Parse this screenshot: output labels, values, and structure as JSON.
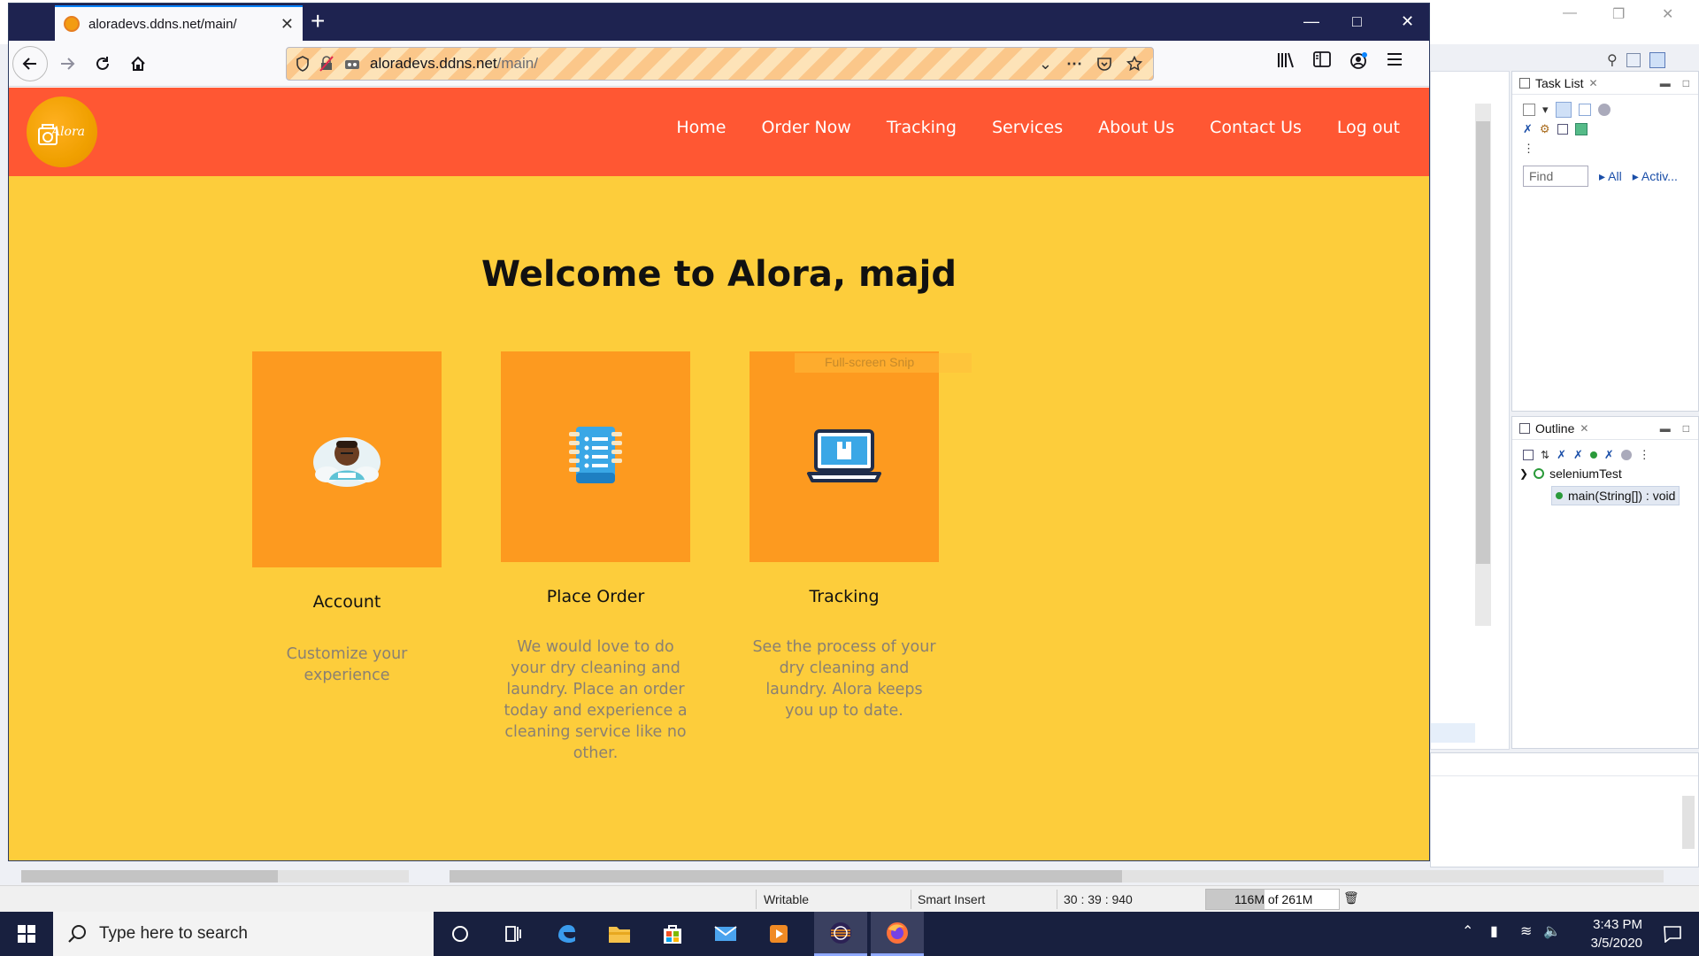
{
  "browser": {
    "tab_title": "aloradevs.ddns.net/main/",
    "url_host": "aloradevs.ddns.net",
    "url_path": "/main/"
  },
  "site": {
    "logo_text": "Alora",
    "nav": [
      "Home",
      "Order Now",
      "Tracking",
      "Services",
      "About Us",
      "Contact Us",
      "Log out"
    ],
    "welcome": "Welcome to Alora, majd",
    "cards": [
      {
        "title": "Account",
        "description": "Customize your experience",
        "icon": "user-avatar-icon"
      },
      {
        "title": "Place Order",
        "description": "We would love to do your dry cleaning and laundry. Place an order today and experience a cleaning service like no other.",
        "icon": "notebook-icon"
      },
      {
        "title": "Tracking",
        "description": "See the process of your dry cleaning and laundry. Alora keeps you up to date.",
        "icon": "laptop-icon"
      }
    ],
    "overlay_text": "Full-screen Snip",
    "colors": {
      "header": "#ff5733",
      "page": "#fdcd3b",
      "card": "#fd9a1f"
    }
  },
  "eclipse": {
    "task_list": {
      "title": "Task List",
      "find_placeholder": "Find",
      "all_link": "All",
      "activate_link": "Activ..."
    },
    "outline": {
      "title": "Outline",
      "class_name": "seleniumTest",
      "method": "main(String[]) : void"
    },
    "status": {
      "writable": "Writable",
      "insert_mode": "Smart Insert",
      "position": "30 : 39 : 940",
      "memory": "116M of 261M",
      "memory_used_fraction": 0.44
    }
  },
  "taskbar": {
    "search_placeholder": "Type here to search",
    "time": "3:43 PM",
    "date": "3/5/2020"
  }
}
